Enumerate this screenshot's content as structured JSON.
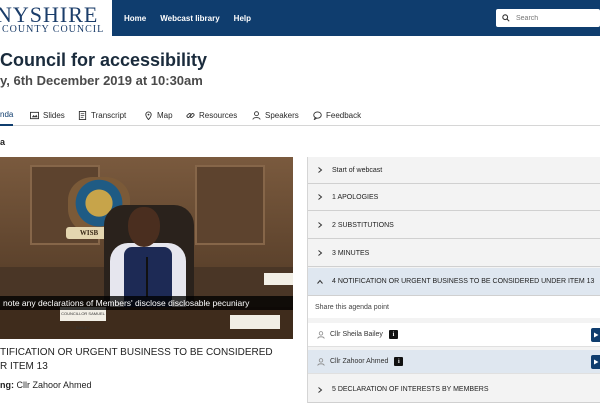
{
  "header": {
    "logo_line1": "NYSHIRE",
    "logo_line2": "COUNTY COUNCIL",
    "nav": [
      {
        "label": "Home"
      },
      {
        "label": "Webcast library"
      },
      {
        "label": "Help"
      }
    ],
    "search_placeholder": "Search"
  },
  "meeting": {
    "title": "Council for accessibility",
    "date": "y, 6th December 2019 at 10:30am"
  },
  "tabs": [
    {
      "label": "nda",
      "icon": "list-icon",
      "active": true
    },
    {
      "label": "Slides",
      "icon": "slides-icon"
    },
    {
      "label": "Transcript",
      "icon": "document-icon"
    },
    {
      "label": "Map",
      "icon": "map-pin-icon"
    },
    {
      "label": "Resources",
      "icon": "link-icon"
    },
    {
      "label": "Speakers",
      "icon": "person-icon"
    },
    {
      "label": "Feedback",
      "icon": "speech-bubble-icon"
    }
  ],
  "section_label": "a",
  "video": {
    "crest_text": "WISB",
    "sign_text": "COUNCILLOR SAMUEL BAILEY",
    "caption": " note any declarations of Members' disclose disclosable pecuniary"
  },
  "current_item": {
    "title_line1": "TIFICATION OR URGENT BUSINESS TO BE CONSIDERED",
    "title_line2": "R ITEM 13",
    "speaker_prefix": "ng:",
    "speaker_name": "Cllr Zahoor Ahmed"
  },
  "agenda": {
    "items": [
      {
        "label": "Start of webcast"
      },
      {
        "label": "1 APOLOGIES"
      },
      {
        "label": "2 SUBSTITUTIONS"
      },
      {
        "label": "3 MINUTES"
      },
      {
        "label": "4 NOTIFICATION OR URGENT BUSINESS TO BE CONSIDERED UNDER ITEM 13",
        "open": true
      }
    ],
    "share_label": "Share this agenda point",
    "speakers": [
      {
        "name": "Cllr Sheila Bailey"
      },
      {
        "name": "Cllr Zahoor Ahmed",
        "active": true
      }
    ],
    "next_item": "5 DECLARATION OF INTERESTS BY MEMBERS"
  },
  "colors": {
    "brand": "#0f3d6e",
    "active_row": "#dfe7f0"
  }
}
